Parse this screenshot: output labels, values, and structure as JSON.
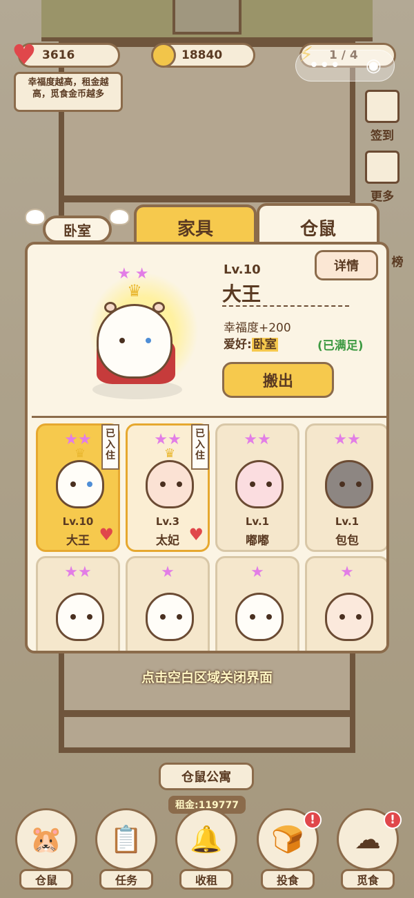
{
  "status": {
    "hearts": "3616",
    "coins": "18840",
    "energy": "1 / 4",
    "tip": "幸福度越高，租金越高，觅食金币越多"
  },
  "side": {
    "checkin": "签到",
    "more": "更多",
    "rank": "榜"
  },
  "tabs": {
    "furniture": "家具",
    "hamster": "仓鼠",
    "room": "卧室"
  },
  "detail": {
    "level": "Lv.10",
    "name": "大王",
    "happiness": "幸福度+200",
    "hobby_label": "爱好:",
    "hobby_value": "卧室",
    "satisfied": "(已满足)",
    "details_button": "详情",
    "move_out_button": "搬出",
    "stars": 2
  },
  "cards": [
    {
      "level": "Lv.10",
      "name": "大王",
      "badge": "已入住",
      "stars": 2,
      "heart": true
    },
    {
      "level": "Lv.3",
      "name": "太妃",
      "badge": "已入住",
      "stars": 2,
      "heart": true
    },
    {
      "level": "Lv.1",
      "name": "嘟嘟",
      "badge": "",
      "stars": 2,
      "heart": false
    },
    {
      "level": "Lv.1",
      "name": "包包",
      "badge": "",
      "stars": 2,
      "heart": false
    },
    {
      "level": "",
      "name": "",
      "badge": "",
      "stars": 2,
      "heart": false
    },
    {
      "level": "",
      "name": "",
      "badge": "",
      "stars": 1,
      "heart": false
    },
    {
      "level": "",
      "name": "",
      "badge": "",
      "stars": 1,
      "heart": false
    },
    {
      "level": "",
      "name": "",
      "badge": "",
      "stars": 1,
      "heart": false
    }
  ],
  "close_hint": "点击空白区域关闭界面",
  "apartment_sign": "仓鼠公寓",
  "rent": "租金:119777",
  "nav": [
    {
      "label": "仓鼠",
      "icon": "hamster-icon"
    },
    {
      "label": "任务",
      "icon": "task-icon"
    },
    {
      "label": "收租",
      "icon": "bell-icon"
    },
    {
      "label": "投食",
      "icon": "food-icon"
    },
    {
      "label": "觅食",
      "icon": "forage-icon"
    }
  ],
  "colors": {
    "accent": "#f6c94d",
    "border": "#8b6b4b",
    "star": "#e27de6",
    "green": "#3d9a42",
    "heart": "#e0474b"
  }
}
